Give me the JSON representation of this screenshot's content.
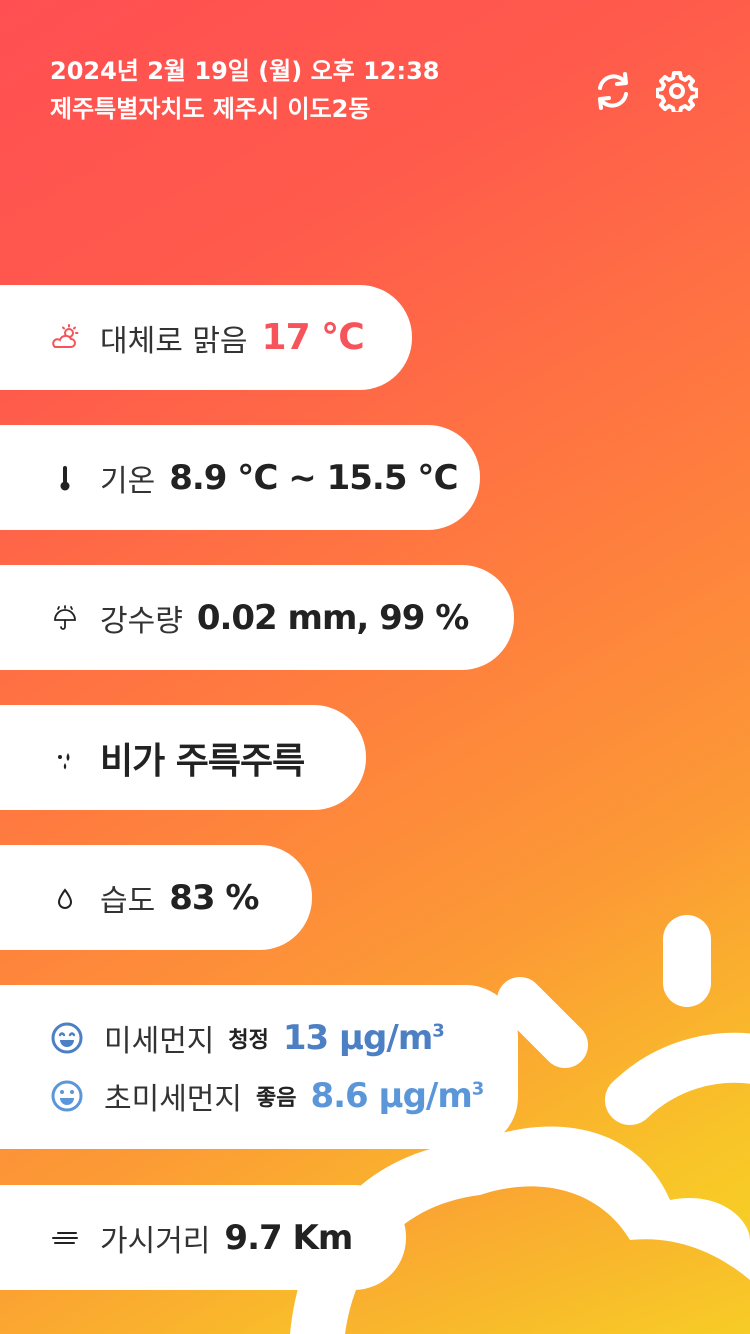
{
  "header": {
    "datetime": "2024년 2월 19일 (월) 오후 12:38",
    "location": "제주특별자치도 제주시 이도2동"
  },
  "actions": {
    "refresh_icon": "refresh-icon",
    "settings_icon": "gear-icon"
  },
  "weather": {
    "condition": "대체로 맑음",
    "temperature": "17 ℃",
    "temp_label": "기온",
    "temp_range": "8.9 ℃ ~ 15.5 ℃",
    "precip_label": "강수량",
    "precip_value": "0.02 mm, 99 %",
    "rain_desc": "비가 주륵주륵",
    "humidity_label": "습도",
    "humidity_value": "83 %",
    "pm10_label": "미세먼지",
    "pm10_grade": "청정",
    "pm10_value": "13 µg/m",
    "pm25_label": "초미세먼지",
    "pm25_grade": "좋음",
    "pm25_value": "8.6 µg/m",
    "cubic": "3",
    "visibility_label": "가시거리",
    "visibility_value": "9.7 Km"
  },
  "colors": {
    "accent_red": "#f6545a",
    "pm_blue": "#4d7fc4",
    "pm_lightblue": "#5b96d9"
  }
}
